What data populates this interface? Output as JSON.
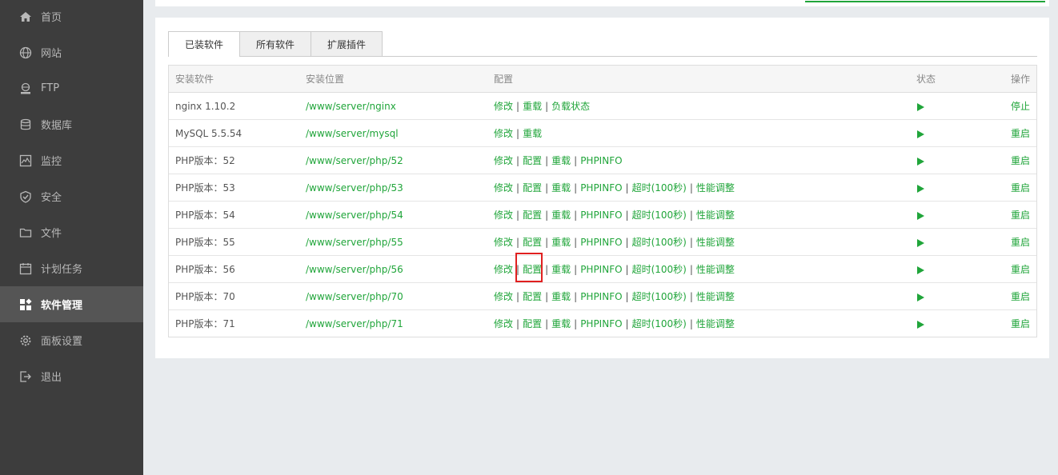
{
  "sidebar": {
    "items": [
      {
        "label": "首页",
        "icon": "home-icon"
      },
      {
        "label": "网站",
        "icon": "globe-icon"
      },
      {
        "label": "FTP",
        "icon": "ftp-icon"
      },
      {
        "label": "数据库",
        "icon": "database-icon"
      },
      {
        "label": "监控",
        "icon": "monitor-icon"
      },
      {
        "label": "安全",
        "icon": "shield-icon"
      },
      {
        "label": "文件",
        "icon": "folder-icon"
      },
      {
        "label": "计划任务",
        "icon": "calendar-icon"
      },
      {
        "label": "软件管理",
        "icon": "apps-icon",
        "active": true
      },
      {
        "label": "面板设置",
        "icon": "gear-icon"
      },
      {
        "label": "退出",
        "icon": "logout-icon"
      }
    ]
  },
  "tabs": [
    "已装软件",
    "所有软件",
    "扩展插件"
  ],
  "table": {
    "headers": {
      "name": "安装软件",
      "path": "安装位置",
      "config": "配置",
      "status": "状态",
      "op": "操作"
    },
    "rows": [
      {
        "name": "nginx 1.10.2",
        "path": "/www/server/nginx",
        "links": [
          "修改",
          "重载",
          "负载状态"
        ],
        "op": "停止"
      },
      {
        "name": "MySQL 5.5.54",
        "path": "/www/server/mysql",
        "links": [
          "修改",
          "重载"
        ],
        "op": "重启"
      },
      {
        "name": "PHP版本：52",
        "path": "/www/server/php/52",
        "links": [
          "修改",
          "配置",
          "重载",
          "PHPINFO"
        ],
        "op": "重启"
      },
      {
        "name": "PHP版本：53",
        "path": "/www/server/php/53",
        "links": [
          "修改",
          "配置",
          "重载",
          "PHPINFO",
          "超时(100秒)",
          "性能调整"
        ],
        "op": "重启"
      },
      {
        "name": "PHP版本：54",
        "path": "/www/server/php/54",
        "links": [
          "修改",
          "配置",
          "重载",
          "PHPINFO",
          "超时(100秒)",
          "性能调整"
        ],
        "op": "重启"
      },
      {
        "name": "PHP版本：55",
        "path": "/www/server/php/55",
        "links": [
          "修改",
          "配置",
          "重载",
          "PHPINFO",
          "超时(100秒)",
          "性能调整"
        ],
        "op": "重启"
      },
      {
        "name": "PHP版本：56",
        "path": "/www/server/php/56",
        "links": [
          "修改",
          "配置",
          "重载",
          "PHPINFO",
          "超时(100秒)",
          "性能调整"
        ],
        "op": "重启"
      },
      {
        "name": "PHP版本：70",
        "path": "/www/server/php/70",
        "links": [
          "修改",
          "配置",
          "重载",
          "PHPINFO",
          "超时(100秒)",
          "性能调整"
        ],
        "op": "重启"
      },
      {
        "name": "PHP版本：71",
        "path": "/www/server/php/71",
        "links": [
          "修改",
          "配置",
          "重载",
          "PHPINFO",
          "超时(100秒)",
          "性能调整"
        ],
        "op": "重启"
      }
    ]
  },
  "colors": {
    "accent": "#20a53a",
    "sidebar": "#3d3d3d",
    "highlight": "#e02020"
  }
}
